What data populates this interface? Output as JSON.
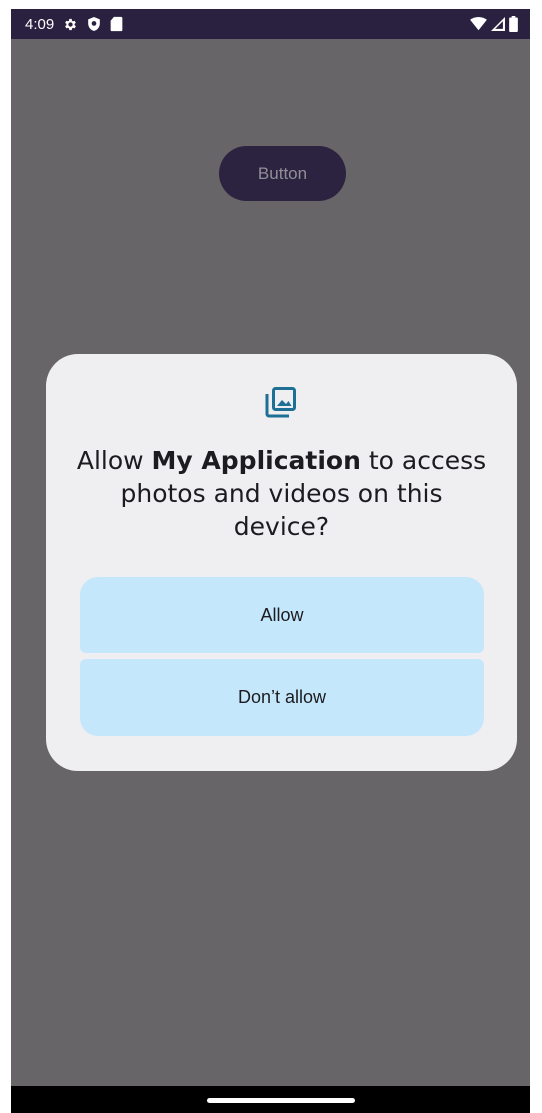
{
  "status_bar": {
    "time": "4:09",
    "left_icons": [
      "settings-icon",
      "shield-icon",
      "sd-card-icon"
    ],
    "right_icons": [
      "wifi-icon",
      "cell-signal-icon",
      "battery-icon"
    ],
    "background": "#2a2040"
  },
  "app": {
    "button_label": "Button",
    "background": "#686568",
    "button_color": "#2c2340"
  },
  "dialog": {
    "icon": "photo-library-icon",
    "title_prefix": "Allow ",
    "app_name": "My Application",
    "title_suffix": " to access photos and videos on this device?",
    "allow_label": "Allow",
    "deny_label": "Don’t allow",
    "background": "#efeff2",
    "button_color": "#c5e7fb",
    "icon_color": "#1e6f96"
  },
  "nav_bar": {
    "home_indicator": "home-indicator"
  }
}
